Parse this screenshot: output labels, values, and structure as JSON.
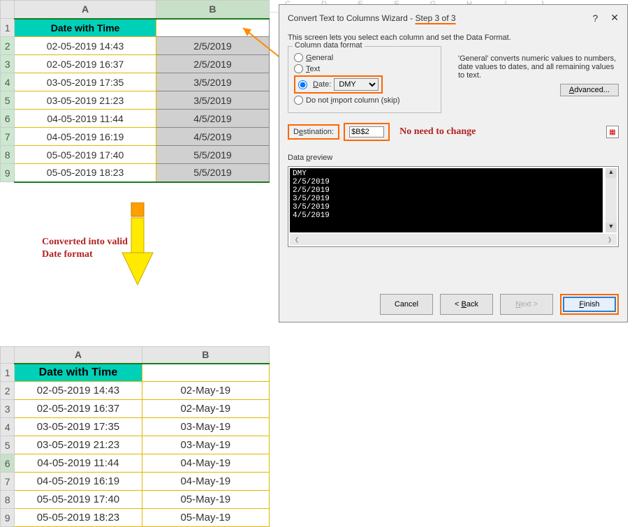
{
  "sheet1": {
    "columns": [
      "A",
      "B",
      "C",
      "D",
      "E",
      "F",
      "G",
      "H",
      "I",
      "J"
    ],
    "header": "Date with Time",
    "rows": [
      {
        "n": "2",
        "a": "02-05-2019 14:43",
        "b": "2/5/2019"
      },
      {
        "n": "3",
        "a": "02-05-2019 16:37",
        "b": "2/5/2019"
      },
      {
        "n": "4",
        "a": "03-05-2019 17:35",
        "b": "3/5/2019"
      },
      {
        "n": "5",
        "a": "03-05-2019 21:23",
        "b": "3/5/2019"
      },
      {
        "n": "6",
        "a": "04-05-2019 11:44",
        "b": "4/5/2019"
      },
      {
        "n": "7",
        "a": "04-05-2019 16:19",
        "b": "4/5/2019"
      },
      {
        "n": "8",
        "a": "05-05-2019 17:40",
        "b": "5/5/2019"
      },
      {
        "n": "9",
        "a": "05-05-2019 18:23",
        "b": "5/5/2019"
      }
    ]
  },
  "sheet2": {
    "header": "Date with Time",
    "rows": [
      {
        "n": "2",
        "a": "02-05-2019 14:43",
        "b": "02-May-19"
      },
      {
        "n": "3",
        "a": "02-05-2019 16:37",
        "b": "02-May-19"
      },
      {
        "n": "4",
        "a": "03-05-2019 17:35",
        "b": "03-May-19"
      },
      {
        "n": "5",
        "a": "03-05-2019 21:23",
        "b": "03-May-19"
      },
      {
        "n": "6",
        "a": "04-05-2019 11:44",
        "b": "04-May-19"
      },
      {
        "n": "7",
        "a": "04-05-2019 16:19",
        "b": "04-May-19"
      },
      {
        "n": "8",
        "a": "05-05-2019 17:40",
        "b": "05-May-19"
      },
      {
        "n": "9",
        "a": "05-05-2019 18:23",
        "b": "05-May-19"
      }
    ]
  },
  "dialog": {
    "title": "Convert Text to Columns Wizard - Step 3 of 3",
    "intro": "This screen lets you select each column and set the Data Format.",
    "fieldset_legend": "Column data format",
    "opt_general": "General",
    "opt_text": "Text",
    "opt_date": "Date:",
    "date_format": "DMY",
    "opt_skip": "Do not import column (skip)",
    "right_text": "'General' converts numeric values to numbers, date values to dates, and all remaining values to text.",
    "advanced": "Advanced...",
    "dest_label": "Destination:",
    "dest_value": "$B$2",
    "dest_note": "No need to change",
    "preview_label": "Data preview",
    "preview_header": "DMY",
    "preview_rows": [
      "2/5/2019",
      "2/5/2019",
      "3/5/2019",
      "3/5/2019",
      "4/5/2019"
    ],
    "btn_cancel": "Cancel",
    "btn_back": "< Back",
    "btn_next": "Next >",
    "btn_finish": "Finish"
  },
  "annotation": {
    "converted": "Converted into valid\nDate format"
  }
}
